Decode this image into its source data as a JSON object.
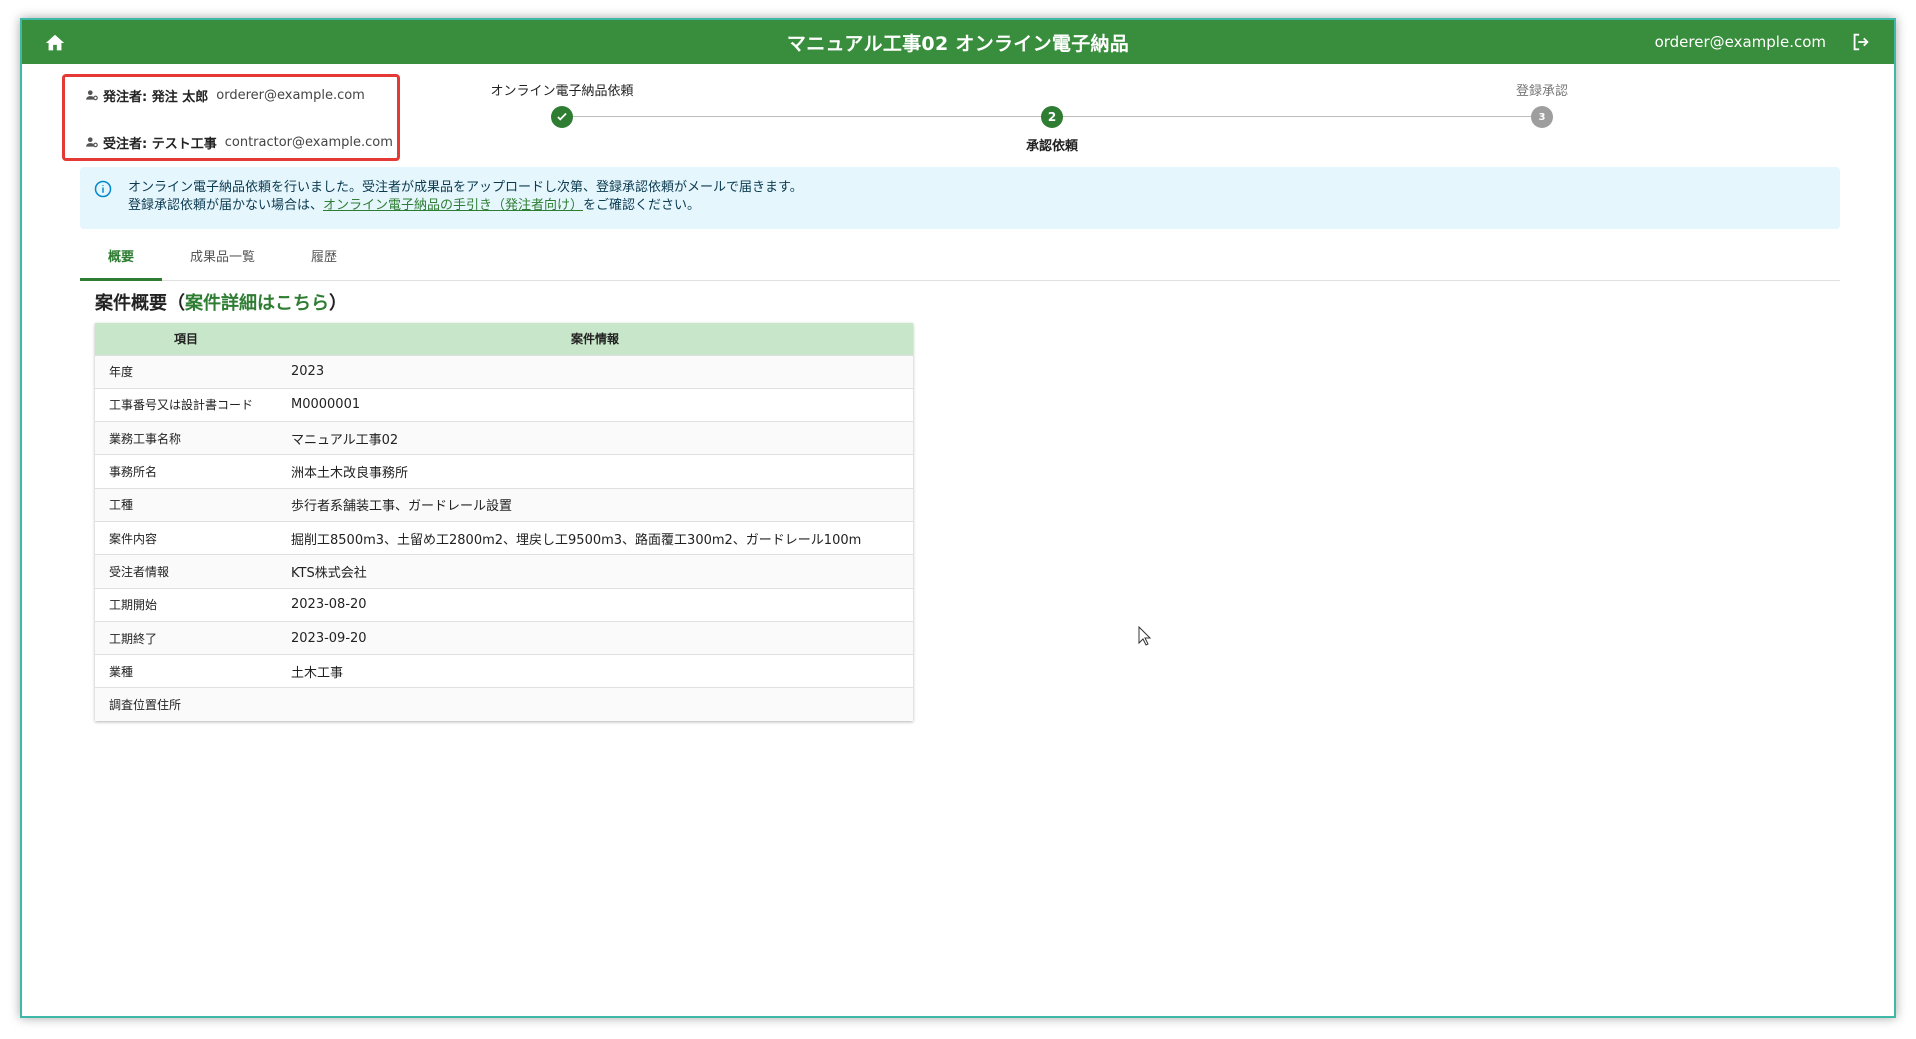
{
  "header": {
    "title": "マニュアル工事02 オンライン電子納品",
    "user_email": "orderer@example.com",
    "home_icon": "home-icon",
    "logout_icon": "logout-icon"
  },
  "parties": {
    "orderer_label": "発注者: 発注 太郎",
    "orderer_email": "orderer@example.com",
    "contractor_label": "受注者: テスト工事",
    "contractor_email": "contractor@example.com"
  },
  "stepper": {
    "steps": [
      {
        "label": "オンライン電子納品依頼",
        "state": "completed"
      },
      {
        "label": "承認依頼",
        "number": "2",
        "state": "active"
      },
      {
        "label": "登録承認",
        "number": "3",
        "state": "pending"
      }
    ]
  },
  "alert": {
    "line1": "オンライン電子納品依頼を行いました。受注者が成果品をアップロードし次第、登録承認依頼がメールで届きます。",
    "line2_prefix": "登録承認依頼が届かない場合は、",
    "line2_link": "オンライン電子納品の手引き（発注者向け）",
    "line2_suffix": "をご確認ください。"
  },
  "tabs": [
    {
      "label": "概要",
      "active": true
    },
    {
      "label": "成果品一覧",
      "active": false
    },
    {
      "label": "履歴",
      "active": false
    }
  ],
  "summary": {
    "title_prefix": "案件概要（",
    "title_link": "案件詳細はこちら",
    "title_suffix": "）",
    "columns": [
      "項目",
      "案件情報"
    ],
    "rows": [
      {
        "item": "年度",
        "value": "2023"
      },
      {
        "item": "工事番号又は設計書コード",
        "value": "M0000001"
      },
      {
        "item": "業務工事名称",
        "value": "マニュアル工事02"
      },
      {
        "item": "事務所名",
        "value": "洲本土木改良事務所"
      },
      {
        "item": "工種",
        "value": "歩行者系舗装工事、ガードレール設置"
      },
      {
        "item": "案件内容",
        "value": "掘削工8500m3、土留め工2800m2、埋戻し工9500m3、路面覆工300m2、ガードレール100m"
      },
      {
        "item": "受注者情報",
        "value": "KTS株式会社"
      },
      {
        "item": "工期開始",
        "value": "2023-08-20"
      },
      {
        "item": "工期終了",
        "value": "2023-09-20"
      },
      {
        "item": "業種",
        "value": "土木工事"
      },
      {
        "item": "調査位置住所",
        "value": ""
      }
    ]
  },
  "colors": {
    "primary": "#388e3c",
    "accent": "#2e7d32",
    "header_row": "#c8e6c9",
    "alert_bg": "#e5f6fd",
    "highlight_border": "#e53935"
  }
}
